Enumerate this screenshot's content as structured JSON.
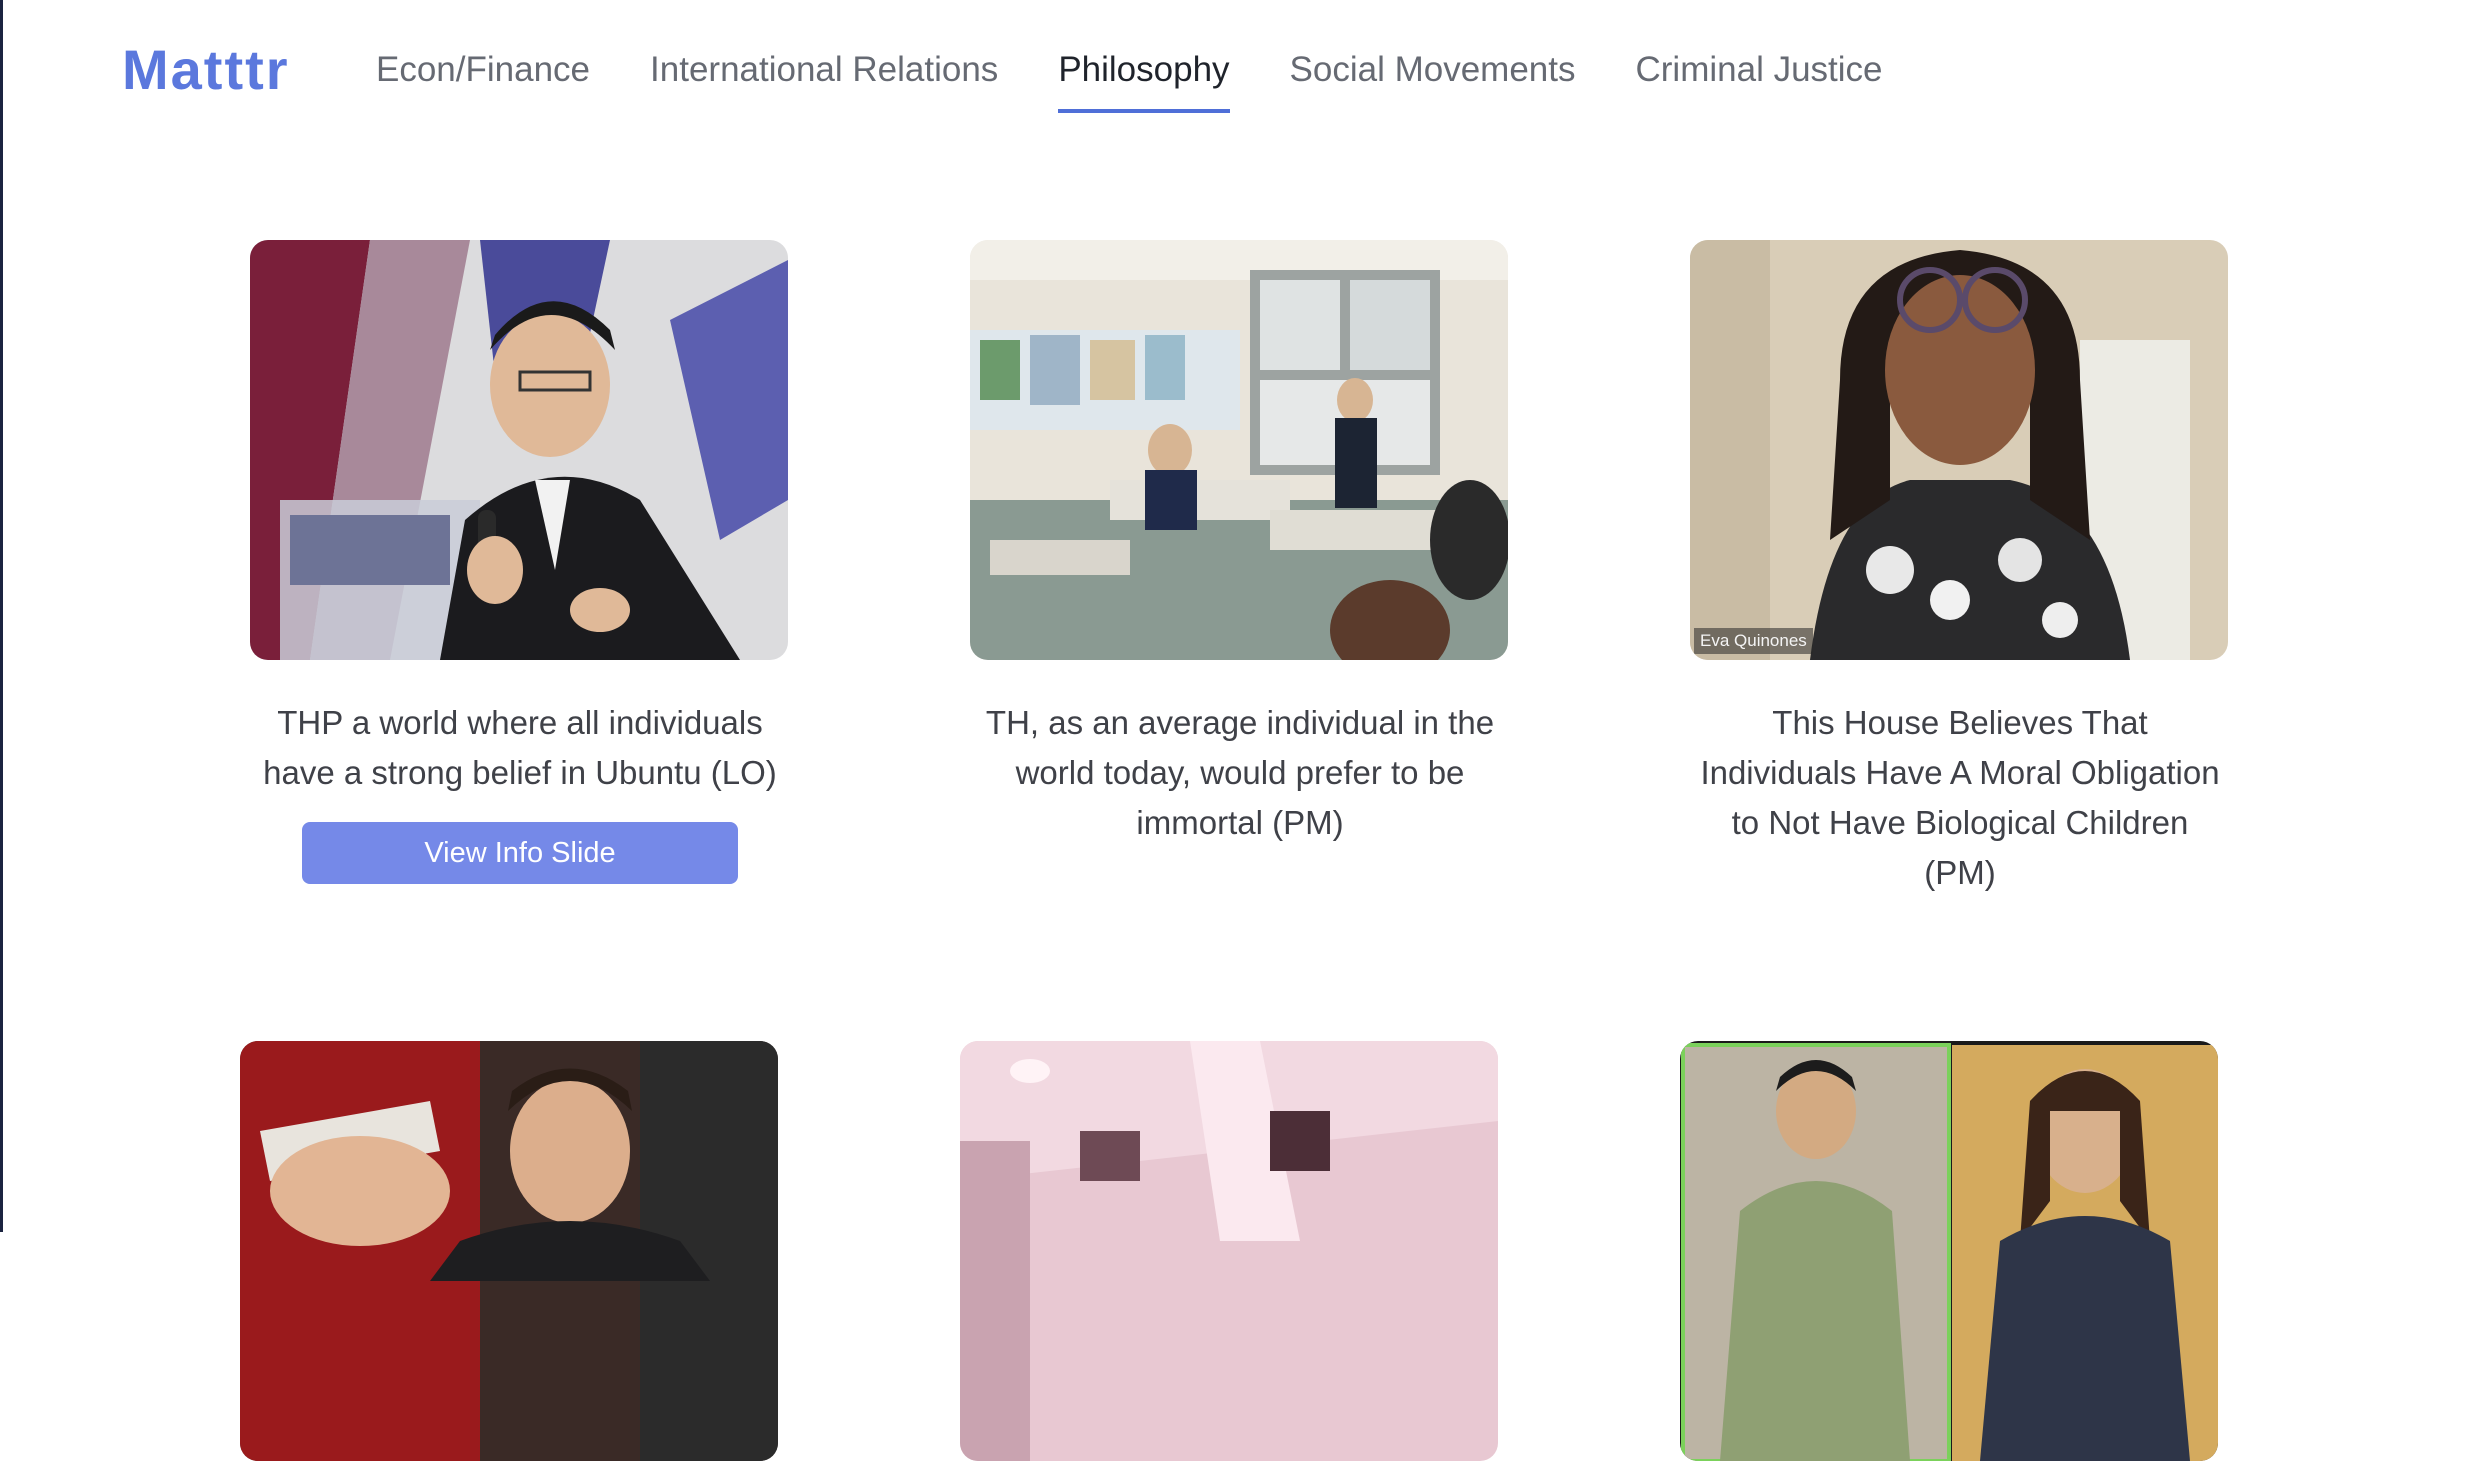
{
  "brand": {
    "logo_text": "Matttr",
    "accent_color": "#5b78dd"
  },
  "nav": {
    "items": [
      {
        "label": "Econ/Finance",
        "active": false
      },
      {
        "label": "International Relations",
        "active": false
      },
      {
        "label": "Philosophy",
        "active": true
      },
      {
        "label": "Social Movements",
        "active": false
      },
      {
        "label": "Criminal Justice",
        "active": false
      }
    ]
  },
  "cards": [
    {
      "title": "THP a world where all individuals have a strong belief in Ubuntu (LO)",
      "button_label": "View Info Slide",
      "image": "speaker-at-podium-photo"
    },
    {
      "title": "TH, as an average individual in the world today, would prefer to be immortal (PM)",
      "image": "classroom-debate-photo"
    },
    {
      "title": "This House Believes That Individuals Have A Moral Obligation to Not Have Biological Children (PM)",
      "image": "video-call-speaker-photo",
      "caption": "Eva Quinones"
    },
    {
      "image": "speaker-holding-card-photo"
    },
    {
      "image": "pink-room-photo"
    },
    {
      "image": "split-video-call-photo"
    }
  ]
}
